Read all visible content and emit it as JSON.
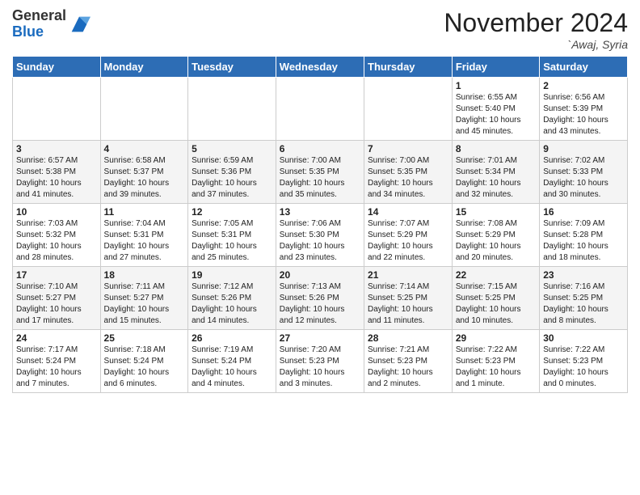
{
  "header": {
    "logo_line1": "General",
    "logo_line2": "Blue",
    "month": "November 2024",
    "location": "`Awaj, Syria"
  },
  "weekdays": [
    "Sunday",
    "Monday",
    "Tuesday",
    "Wednesday",
    "Thursday",
    "Friday",
    "Saturday"
  ],
  "weeks": [
    [
      {
        "day": "",
        "info": ""
      },
      {
        "day": "",
        "info": ""
      },
      {
        "day": "",
        "info": ""
      },
      {
        "day": "",
        "info": ""
      },
      {
        "day": "",
        "info": ""
      },
      {
        "day": "1",
        "info": "Sunrise: 6:55 AM\nSunset: 5:40 PM\nDaylight: 10 hours\nand 45 minutes."
      },
      {
        "day": "2",
        "info": "Sunrise: 6:56 AM\nSunset: 5:39 PM\nDaylight: 10 hours\nand 43 minutes."
      }
    ],
    [
      {
        "day": "3",
        "info": "Sunrise: 6:57 AM\nSunset: 5:38 PM\nDaylight: 10 hours\nand 41 minutes."
      },
      {
        "day": "4",
        "info": "Sunrise: 6:58 AM\nSunset: 5:37 PM\nDaylight: 10 hours\nand 39 minutes."
      },
      {
        "day": "5",
        "info": "Sunrise: 6:59 AM\nSunset: 5:36 PM\nDaylight: 10 hours\nand 37 minutes."
      },
      {
        "day": "6",
        "info": "Sunrise: 7:00 AM\nSunset: 5:35 PM\nDaylight: 10 hours\nand 35 minutes."
      },
      {
        "day": "7",
        "info": "Sunrise: 7:00 AM\nSunset: 5:35 PM\nDaylight: 10 hours\nand 34 minutes."
      },
      {
        "day": "8",
        "info": "Sunrise: 7:01 AM\nSunset: 5:34 PM\nDaylight: 10 hours\nand 32 minutes."
      },
      {
        "day": "9",
        "info": "Sunrise: 7:02 AM\nSunset: 5:33 PM\nDaylight: 10 hours\nand 30 minutes."
      }
    ],
    [
      {
        "day": "10",
        "info": "Sunrise: 7:03 AM\nSunset: 5:32 PM\nDaylight: 10 hours\nand 28 minutes."
      },
      {
        "day": "11",
        "info": "Sunrise: 7:04 AM\nSunset: 5:31 PM\nDaylight: 10 hours\nand 27 minutes."
      },
      {
        "day": "12",
        "info": "Sunrise: 7:05 AM\nSunset: 5:31 PM\nDaylight: 10 hours\nand 25 minutes."
      },
      {
        "day": "13",
        "info": "Sunrise: 7:06 AM\nSunset: 5:30 PM\nDaylight: 10 hours\nand 23 minutes."
      },
      {
        "day": "14",
        "info": "Sunrise: 7:07 AM\nSunset: 5:29 PM\nDaylight: 10 hours\nand 22 minutes."
      },
      {
        "day": "15",
        "info": "Sunrise: 7:08 AM\nSunset: 5:29 PM\nDaylight: 10 hours\nand 20 minutes."
      },
      {
        "day": "16",
        "info": "Sunrise: 7:09 AM\nSunset: 5:28 PM\nDaylight: 10 hours\nand 18 minutes."
      }
    ],
    [
      {
        "day": "17",
        "info": "Sunrise: 7:10 AM\nSunset: 5:27 PM\nDaylight: 10 hours\nand 17 minutes."
      },
      {
        "day": "18",
        "info": "Sunrise: 7:11 AM\nSunset: 5:27 PM\nDaylight: 10 hours\nand 15 minutes."
      },
      {
        "day": "19",
        "info": "Sunrise: 7:12 AM\nSunset: 5:26 PM\nDaylight: 10 hours\nand 14 minutes."
      },
      {
        "day": "20",
        "info": "Sunrise: 7:13 AM\nSunset: 5:26 PM\nDaylight: 10 hours\nand 12 minutes."
      },
      {
        "day": "21",
        "info": "Sunrise: 7:14 AM\nSunset: 5:25 PM\nDaylight: 10 hours\nand 11 minutes."
      },
      {
        "day": "22",
        "info": "Sunrise: 7:15 AM\nSunset: 5:25 PM\nDaylight: 10 hours\nand 10 minutes."
      },
      {
        "day": "23",
        "info": "Sunrise: 7:16 AM\nSunset: 5:25 PM\nDaylight: 10 hours\nand 8 minutes."
      }
    ],
    [
      {
        "day": "24",
        "info": "Sunrise: 7:17 AM\nSunset: 5:24 PM\nDaylight: 10 hours\nand 7 minutes."
      },
      {
        "day": "25",
        "info": "Sunrise: 7:18 AM\nSunset: 5:24 PM\nDaylight: 10 hours\nand 6 minutes."
      },
      {
        "day": "26",
        "info": "Sunrise: 7:19 AM\nSunset: 5:24 PM\nDaylight: 10 hours\nand 4 minutes."
      },
      {
        "day": "27",
        "info": "Sunrise: 7:20 AM\nSunset: 5:23 PM\nDaylight: 10 hours\nand 3 minutes."
      },
      {
        "day": "28",
        "info": "Sunrise: 7:21 AM\nSunset: 5:23 PM\nDaylight: 10 hours\nand 2 minutes."
      },
      {
        "day": "29",
        "info": "Sunrise: 7:22 AM\nSunset: 5:23 PM\nDaylight: 10 hours\nand 1 minute."
      },
      {
        "day": "30",
        "info": "Sunrise: 7:22 AM\nSunset: 5:23 PM\nDaylight: 10 hours\nand 0 minutes."
      }
    ]
  ]
}
